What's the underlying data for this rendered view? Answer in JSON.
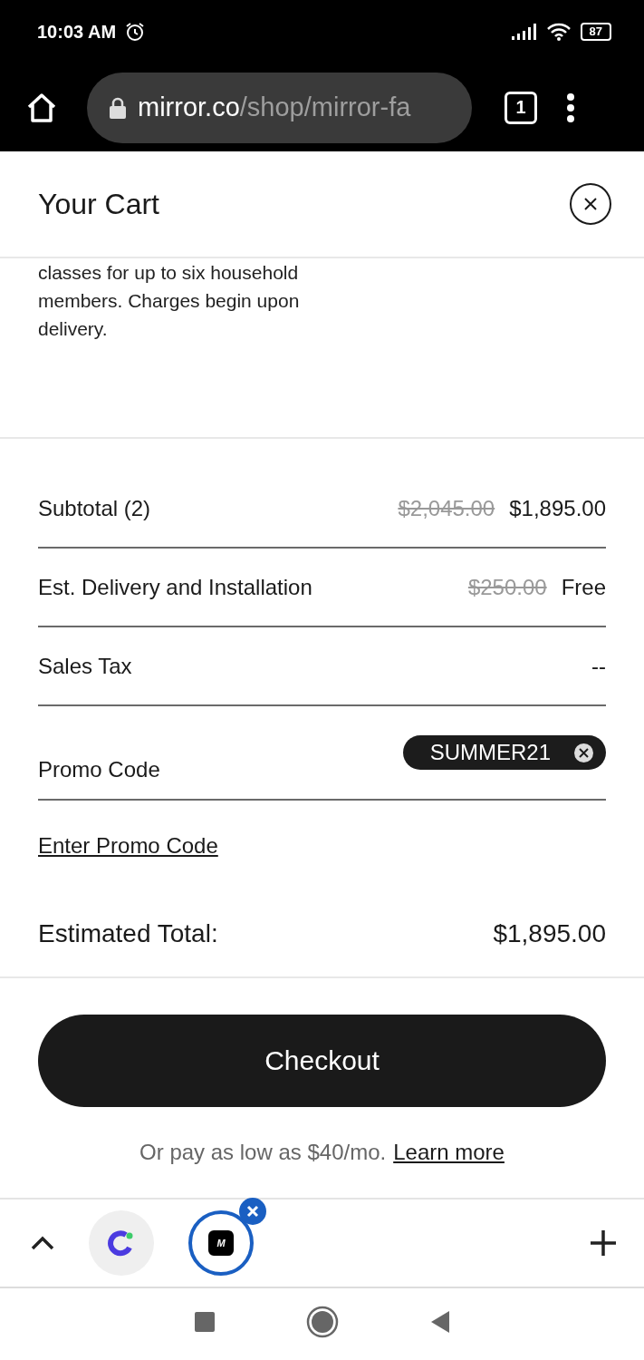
{
  "status_bar": {
    "time": "10:03 AM",
    "battery": "87"
  },
  "browser": {
    "url_host": "mirror.co",
    "url_path": "/shop/mirror-fa",
    "tab_count": "1"
  },
  "cart": {
    "title": "Your Cart",
    "description": "classes for up to six household members. Charges begin upon delivery.",
    "rows": [
      {
        "kind": "price",
        "label": "Subtotal (2)",
        "original": "$2,045.00",
        "value": "$1,895.00"
      },
      {
        "kind": "price",
        "label": "Est. Delivery and Installation",
        "original": "$250.00",
        "value": "Free"
      },
      {
        "kind": "price",
        "label": "Sales Tax",
        "value": "--"
      },
      {
        "kind": "promo",
        "label": "Promo Code",
        "code": "SUMMER21"
      }
    ],
    "promo_link": "Enter Promo Code",
    "total": {
      "label": "Estimated Total:",
      "value": "$1,895.00"
    },
    "checkout": "Checkout",
    "financing": {
      "text": "Or pay as low as $40/mo.",
      "link": "Learn more"
    }
  },
  "tab_strip": {
    "tabs": [
      {
        "kind": "app",
        "selected": false
      },
      {
        "kind": "letter",
        "letter": "M",
        "selected": true
      }
    ]
  }
}
